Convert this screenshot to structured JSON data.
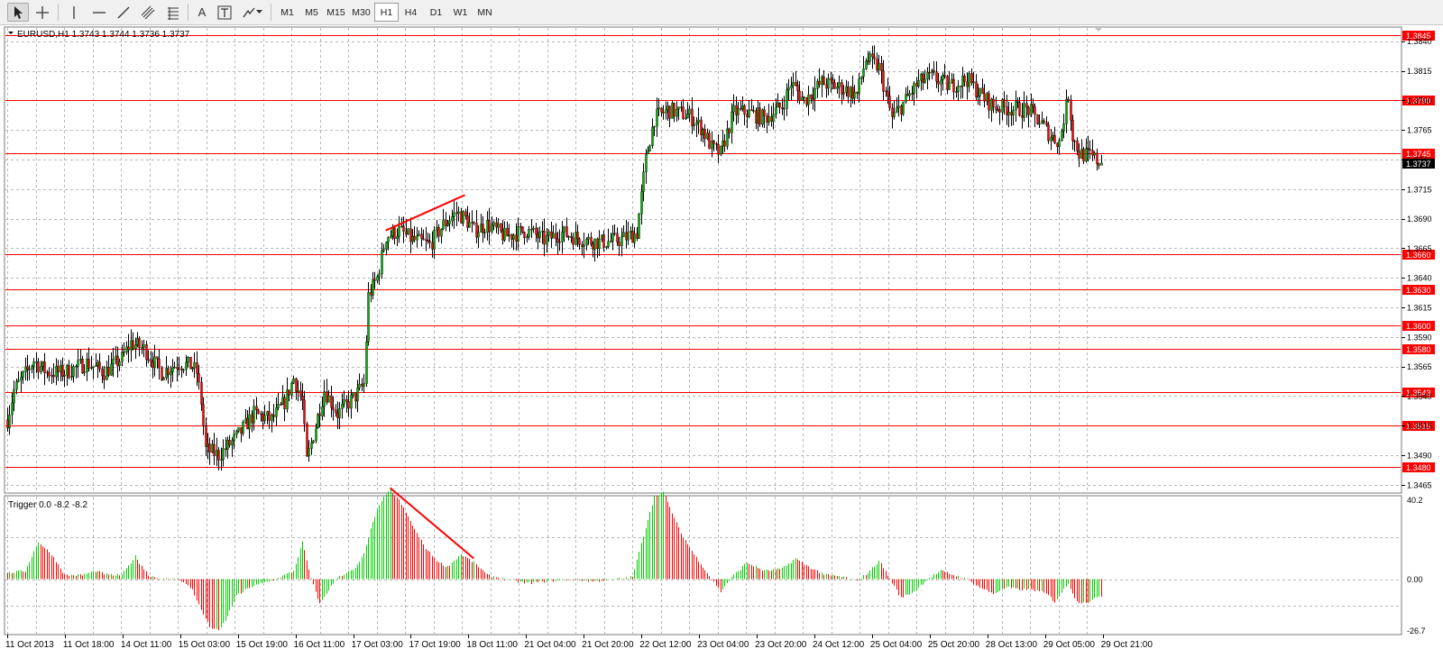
{
  "toolbar": {
    "tools": [
      {
        "name": "cursor-tool",
        "icon": "arrow-cursor-icon"
      },
      {
        "name": "crosshair-tool",
        "icon": "crosshair-icon"
      },
      {
        "name": "vertical-line-tool",
        "icon": "vertical-line-icon"
      },
      {
        "name": "horizontal-line-tool",
        "icon": "horizontal-line-icon"
      },
      {
        "name": "trendline-tool",
        "icon": "trendline-icon"
      },
      {
        "name": "equidistant-channel-tool",
        "icon": "channel-icon"
      },
      {
        "name": "fibonacci-tool",
        "icon": "fibonacci-icon"
      },
      {
        "name": "text-tool",
        "icon": "text-A-icon"
      },
      {
        "name": "text-label-tool",
        "icon": "text-label-icon"
      },
      {
        "name": "shapes-dropdown",
        "icon": "shapes-icon"
      }
    ],
    "text_tool_label": "A",
    "timeframes": [
      "M1",
      "M5",
      "M15",
      "M30",
      "H1",
      "H4",
      "D1",
      "W1",
      "MN"
    ],
    "active_timeframe": "H1"
  },
  "main_chart": {
    "info": "EURUSD,H1  1.3743 1.3744 1.3736 1.3737",
    "price_levels": [
      "1.3840",
      "1.3815",
      "1.3790",
      "1.3765",
      "1.3740",
      "1.3715",
      "1.3690",
      "1.3665",
      "1.3640",
      "1.3615",
      "1.3590",
      "1.3565",
      "1.3540",
      "1.3515",
      "1.3490",
      "1.3465"
    ],
    "horizontal_lines": [
      "1.3845",
      "1.3790",
      "1.3745",
      "1.3660",
      "1.3630",
      "1.3600",
      "1.3580",
      "1.3543",
      "1.3515",
      "1.3480"
    ],
    "current_price": "1.3737",
    "colors": {
      "line": "#ff0000",
      "bull": "#00b000",
      "bear": "#ff0000",
      "grid": "#b8b8b8"
    }
  },
  "indicator": {
    "info": "Trigger 0.0 -8.2 -8.2",
    "levels": [
      "40.2",
      "0.00",
      "-26.7"
    ]
  },
  "time_labels": [
    "11 Oct 2013",
    "11 Oct 18:00",
    "14 Oct 11:00",
    "15 Oct 03:00",
    "15 Oct 19:00",
    "16 Oct 11:00",
    "17 Oct 03:00",
    "17 Oct 19:00",
    "18 Oct 11:00",
    "21 Oct 04:00",
    "21 Oct 20:00",
    "22 Oct 12:00",
    "23 Oct 04:00",
    "23 Oct 20:00",
    "24 Oct 12:00",
    "25 Oct 04:00",
    "25 Oct 20:00",
    "28 Oct 13:00",
    "29 Oct 05:00",
    "29 Oct 21:00"
  ],
  "chart_data": {
    "type": "candlestick",
    "symbol": "EURUSD",
    "timeframe": "H1",
    "ohlc_last": {
      "open": 1.3743,
      "high": 1.3744,
      "low": 1.3736,
      "close": 1.3737
    },
    "y_range": [
      1.3458,
      1.3852
    ],
    "anchors": [
      [
        0,
        1.352
      ],
      [
        3,
        1.3545
      ],
      [
        12,
        1.357
      ],
      [
        18,
        1.356
      ],
      [
        26,
        1.356
      ],
      [
        36,
        1.3568
      ],
      [
        44,
        1.356
      ],
      [
        52,
        1.3572
      ],
      [
        56,
        1.3585
      ],
      [
        62,
        1.358
      ],
      [
        70,
        1.356
      ],
      [
        78,
        1.3568
      ],
      [
        84,
        1.3565
      ],
      [
        86,
        1.356
      ],
      [
        88,
        1.3535
      ],
      [
        90,
        1.3495
      ],
      [
        96,
        1.349
      ],
      [
        104,
        1.3505
      ],
      [
        112,
        1.3525
      ],
      [
        120,
        1.352
      ],
      [
        126,
        1.3535
      ],
      [
        130,
        1.3555
      ],
      [
        134,
        1.3535
      ],
      [
        136,
        1.3485
      ],
      [
        140,
        1.3515
      ],
      [
        144,
        1.3545
      ],
      [
        150,
        1.3525
      ],
      [
        158,
        1.354
      ],
      [
        162,
        1.355
      ],
      [
        164,
        1.3625
      ],
      [
        168,
        1.364
      ],
      [
        172,
        1.3675
      ],
      [
        178,
        1.368
      ],
      [
        184,
        1.3672
      ],
      [
        192,
        1.3668
      ],
      [
        198,
        1.3685
      ],
      [
        204,
        1.3695
      ],
      [
        208,
        1.369
      ],
      [
        212,
        1.368
      ],
      [
        218,
        1.3685
      ],
      [
        226,
        1.3675
      ],
      [
        236,
        1.368
      ],
      [
        244,
        1.3672
      ],
      [
        252,
        1.3678
      ],
      [
        262,
        1.3672
      ],
      [
        270,
        1.367
      ],
      [
        278,
        1.3672
      ],
      [
        286,
        1.3678
      ],
      [
        290,
        1.374
      ],
      [
        294,
        1.3775
      ],
      [
        300,
        1.3782
      ],
      [
        310,
        1.3777
      ],
      [
        316,
        1.3765
      ],
      [
        320,
        1.375
      ],
      [
        324,
        1.3745
      ],
      [
        330,
        1.378
      ],
      [
        336,
        1.378
      ],
      [
        344,
        1.3775
      ],
      [
        352,
        1.3785
      ],
      [
        356,
        1.3805
      ],
      [
        362,
        1.379
      ],
      [
        370,
        1.3805
      ],
      [
        380,
        1.38
      ],
      [
        386,
        1.3795
      ],
      [
        390,
        1.3825
      ],
      [
        396,
        1.3818
      ],
      [
        402,
        1.3775
      ],
      [
        408,
        1.379
      ],
      [
        414,
        1.3805
      ],
      [
        420,
        1.381
      ],
      [
        428,
        1.3802
      ],
      [
        436,
        1.3808
      ],
      [
        442,
        1.3795
      ],
      [
        448,
        1.3785
      ],
      [
        456,
        1.3783
      ],
      [
        464,
        1.3782
      ],
      [
        470,
        1.377
      ],
      [
        474,
        1.376
      ],
      [
        478,
        1.3755
      ],
      [
        482,
        1.3795
      ],
      [
        484,
        1.376
      ],
      [
        487,
        1.3745
      ],
      [
        492,
        1.3743
      ],
      [
        496,
        1.3738
      ]
    ],
    "ranges": {
      "price": [
        1.3458,
        1.3852
      ],
      "trigger": [
        -26.7,
        40.2
      ]
    },
    "trigger_anchors": [
      [
        0,
        3
      ],
      [
        8,
        4
      ],
      [
        14,
        18
      ],
      [
        20,
        12
      ],
      [
        26,
        2
      ],
      [
        34,
        2
      ],
      [
        40,
        4
      ],
      [
        46,
        2
      ],
      [
        52,
        2
      ],
      [
        58,
        11
      ],
      [
        64,
        2
      ],
      [
        70,
        0
      ],
      [
        78,
        0
      ],
      [
        84,
        -5
      ],
      [
        88,
        -15
      ],
      [
        92,
        -23
      ],
      [
        96,
        -25
      ],
      [
        100,
        -18
      ],
      [
        104,
        -8
      ],
      [
        110,
        -4
      ],
      [
        116,
        -2
      ],
      [
        122,
        0
      ],
      [
        130,
        4
      ],
      [
        134,
        18
      ],
      [
        138,
        0
      ],
      [
        142,
        -12
      ],
      [
        146,
        -5
      ],
      [
        150,
        1
      ],
      [
        154,
        3
      ],
      [
        158,
        5
      ],
      [
        162,
        12
      ],
      [
        166,
        28
      ],
      [
        170,
        38
      ],
      [
        174,
        43
      ],
      [
        178,
        38
      ],
      [
        182,
        30
      ],
      [
        186,
        22
      ],
      [
        190,
        15
      ],
      [
        196,
        8
      ],
      [
        200,
        6
      ],
      [
        206,
        12
      ],
      [
        212,
        8
      ],
      [
        218,
        2
      ],
      [
        226,
        0
      ],
      [
        236,
        -2
      ],
      [
        246,
        -1
      ],
      [
        256,
        0
      ],
      [
        266,
        -1
      ],
      [
        276,
        0
      ],
      [
        284,
        1
      ],
      [
        290,
        25
      ],
      [
        294,
        40
      ],
      [
        298,
        42
      ],
      [
        302,
        32
      ],
      [
        306,
        22
      ],
      [
        312,
        12
      ],
      [
        318,
        3
      ],
      [
        324,
        -6
      ],
      [
        330,
        2
      ],
      [
        336,
        8
      ],
      [
        344,
        4
      ],
      [
        352,
        5
      ],
      [
        358,
        10
      ],
      [
        364,
        6
      ],
      [
        372,
        2
      ],
      [
        380,
        1
      ],
      [
        386,
        -1
      ],
      [
        392,
        4
      ],
      [
        396,
        9
      ],
      [
        400,
        2
      ],
      [
        406,
        -9
      ],
      [
        412,
        -6
      ],
      [
        418,
        0
      ],
      [
        424,
        4
      ],
      [
        430,
        2
      ],
      [
        436,
        0
      ],
      [
        442,
        -4
      ],
      [
        448,
        -7
      ],
      [
        454,
        -4
      ],
      [
        460,
        -5
      ],
      [
        466,
        -5
      ],
      [
        472,
        -7
      ],
      [
        476,
        -11
      ],
      [
        482,
        -2
      ],
      [
        486,
        -11
      ],
      [
        492,
        -11
      ],
      [
        496,
        -8
      ]
    ],
    "annotations": [
      {
        "type": "trendline",
        "chart": "price",
        "from": [
          172,
          1.368
        ],
        "to": [
          208,
          1.371
        ]
      },
      {
        "type": "trendline",
        "chart": "indicator",
        "from": [
          174,
          44
        ],
        "to": [
          212,
          10
        ]
      }
    ]
  }
}
